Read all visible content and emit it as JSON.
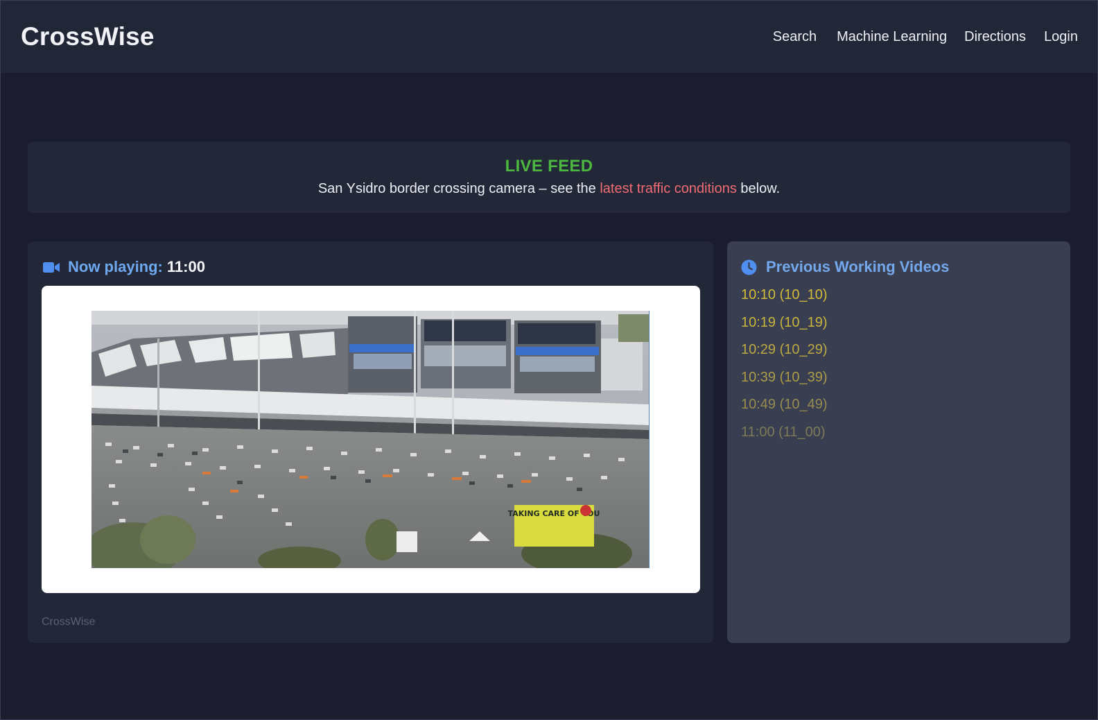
{
  "nav": {
    "brand": "CrossWise",
    "links": [
      "Search",
      "Machine Learning",
      "Directions",
      "Login"
    ]
  },
  "banner": {
    "title": "LIVE FEED",
    "text_before": "San Ysidro border crossing camera – see the ",
    "link_text": "latest traffic conditions",
    "text_after": " below."
  },
  "player": {
    "icon": "video-camera-icon",
    "now_playing_label": "Now playing:",
    "current_time": "11:00",
    "footer": "CrossWise",
    "sign_text": "TAKING CARE OF YOU"
  },
  "previous": {
    "icon": "clock-icon",
    "title": "Previous Working Videos",
    "items": [
      {
        "label": "10:10 (10_10)",
        "color": "#d2bb3a"
      },
      {
        "label": "10:19 (10_19)",
        "color": "#c9b43c"
      },
      {
        "label": "10:29 (10_29)",
        "color": "#bca942"
      },
      {
        "label": "10:39 (10_39)",
        "color": "#ab9c49"
      },
      {
        "label": "10:49 (10_49)",
        "color": "#968c50"
      },
      {
        "label": "11:00 (11_00)",
        "color": "#7c7a57"
      }
    ]
  },
  "colors": {
    "background": "#1b1c2e",
    "navbar": "#222738",
    "card": "#232838",
    "side_card": "#393e50",
    "live_green": "#4cb83f",
    "link_red": "#f06b74",
    "accent_blue": "#6ea8ef"
  }
}
